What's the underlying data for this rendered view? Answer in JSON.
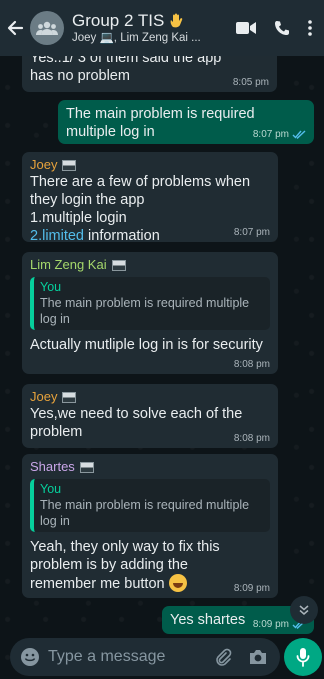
{
  "header": {
    "title": "Group 2 TIS",
    "subtitle": "Joey 💻, Lim Zeng Kai ...",
    "icons": [
      "back-arrow-icon",
      "group-avatar-icon",
      "raised-hand-emoji",
      "video-call-icon",
      "voice-call-icon",
      "more-options-icon"
    ]
  },
  "colors": {
    "header_bg": "#1f2c34",
    "incoming_bubble": "#202c33",
    "outgoing_bubble": "#005c4b",
    "accent_green": "#00a884",
    "read_ticks": "#53bdeb",
    "joey_name": "#e6a23c",
    "lim_name": "#a5d86b",
    "shartes_name": "#c9a6e8"
  },
  "messages": [
    {
      "text": "Yes..1/ 3 of them said the app has no problem",
      "time": "8:05 pm"
    },
    {
      "text": "The main problem is required multiple log in",
      "time": "8:07 pm"
    },
    {
      "sender": "Joey",
      "line1": "There are a few of problems when they login the app",
      "line2": "1.multiple login",
      "line3_link": "2.limited",
      "line3_rest": " information",
      "time": "8:07 pm"
    },
    {
      "sender": "Lim Zeng Kai",
      "quote_name": "You",
      "quote_text": "The main problem is required multiple log in",
      "text": "Actually mutliple log in is for security",
      "time": "8:08 pm"
    },
    {
      "sender": "Joey",
      "text": "Yes,we need to solve each of the problem",
      "time": "8:08 pm"
    },
    {
      "sender": "Shartes",
      "quote_name": "You",
      "quote_text": "The main problem is required multiple log in",
      "text": "Yeah, they only way to fix this problem is by adding the remember me button",
      "time": "8:09 pm"
    },
    {
      "text": "Yes shartes",
      "time": "8:09 pm"
    }
  ],
  "composer": {
    "placeholder": "Type a message",
    "icons": [
      "emoji-icon",
      "attach-icon",
      "camera-icon",
      "mic-icon"
    ]
  }
}
